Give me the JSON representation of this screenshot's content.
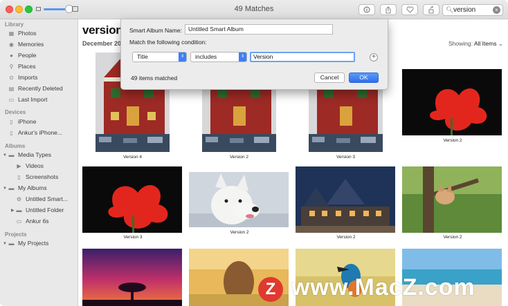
{
  "window": {
    "title": "49 Matches",
    "search_value": "version",
    "toolbar_icons": [
      "info-icon",
      "share-icon",
      "heart-icon",
      "rotate-icon"
    ]
  },
  "sidebar": {
    "sections": [
      {
        "title": "Library",
        "items": [
          "Photos",
          "Memories",
          "People",
          "Places",
          "Imports",
          "Recently Deleted",
          "Last Import"
        ]
      },
      {
        "title": "Devices",
        "items": [
          "iPhone",
          "Ankur's iPhone..."
        ]
      },
      {
        "title": "Albums",
        "items": [
          "Media Types",
          "Videos",
          "Screenshots",
          "My Albums",
          "Untitled Smart...",
          "Untitled Folder",
          "Ankur 6s"
        ]
      },
      {
        "title": "Projects",
        "items": [
          "My Projects"
        ]
      }
    ]
  },
  "main": {
    "title": "version",
    "date_partial": "December 201",
    "showing_label": "Showing:",
    "showing_value": "All Items",
    "captions": [
      "Version 4",
      "Version 2",
      "Version 3",
      "Version 2",
      "Version 3",
      "Version 2",
      "Version 2",
      "Version 2"
    ]
  },
  "dialog": {
    "name_label": "Smart Album Name:",
    "name_value": "Untitled Smart Album",
    "match_label": "Match the following condition:",
    "field_value": "Title",
    "operator_value": "includes",
    "query_value": "Version",
    "count_text": "49 items matched",
    "cancel_label": "Cancel",
    "ok_label": "OK"
  },
  "watermark": {
    "logo": "Z",
    "text": "www.MacZ.com"
  },
  "colors": {
    "accent": "#3d7ff5",
    "close": "#fd5d56",
    "minimize": "#fdbb2f",
    "maximize": "#28c840",
    "watermark_red": "#e03a2f"
  }
}
